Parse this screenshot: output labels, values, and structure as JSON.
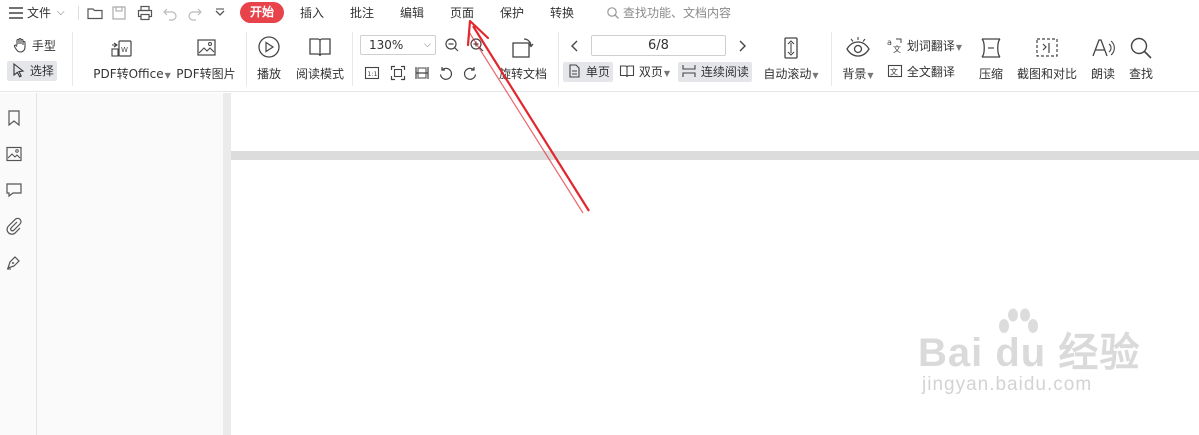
{
  "menubar": {
    "file_label": "文件",
    "tabs": [
      {
        "label": "开始",
        "active": true
      },
      {
        "label": "插入"
      },
      {
        "label": "批注"
      },
      {
        "label": "编辑"
      },
      {
        "label": "页面"
      },
      {
        "label": "保护"
      },
      {
        "label": "转换"
      }
    ],
    "search_placeholder": "查找功能、文档内容",
    "active_color": "#e8434b"
  },
  "toolbar": {
    "hand_label": "手型",
    "select_label": "选择",
    "pdf_to_office_label": "PDF转Office",
    "pdf_to_image_label": "PDF转图片",
    "play_label": "播放",
    "read_mode_label": "阅读模式",
    "zoom_value": "130%",
    "rotate_doc_label": "旋转文档",
    "page_indicator": "6/8",
    "single_page_label": "单页",
    "double_page_label": "双页",
    "continuous_label": "连续阅读",
    "auto_scroll_label": "自动滚动",
    "background_label": "背景",
    "word_translate_label": "划词翻译",
    "full_translate_label": "全文翻译",
    "compress_label": "压缩",
    "screenshot_compare_label": "截图和对比",
    "read_aloud_label": "朗读",
    "find_label": "查找"
  },
  "watermark": {
    "main": "Bai du 经验",
    "sub": "jingyan.baidu.com"
  },
  "annotation": {
    "arrow_color": "#e2262d"
  }
}
